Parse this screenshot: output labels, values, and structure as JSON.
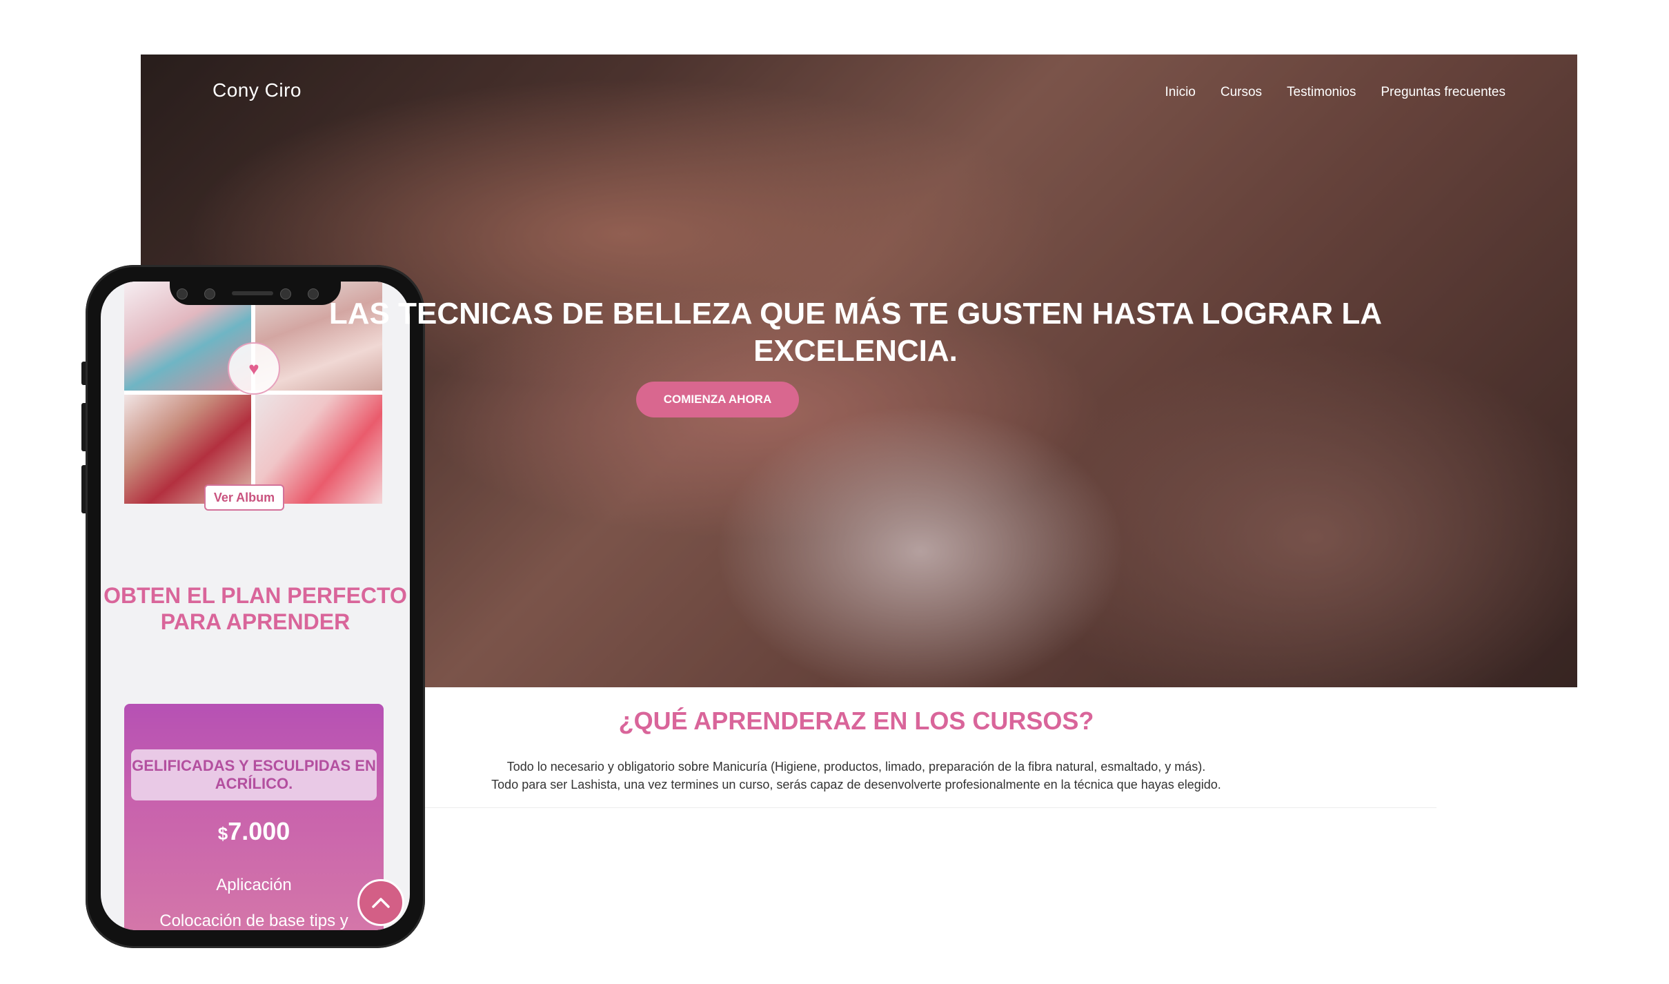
{
  "site": {
    "brand": "Cony Ciro",
    "nav": [
      "Inicio",
      "Cursos",
      "Testimonios",
      "Preguntas frecuentes"
    ]
  },
  "hero": {
    "title": "LAS TECNICAS DE BELLEZA QUE MÁS TE GUSTEN HASTA LOGRAR LA EXCELENCIA.",
    "cta": "COMIENZA AHORA"
  },
  "learn": {
    "title": "¿QUÉ APRENDERAZ EN LOS CURSOS?",
    "line1": "Todo lo necesario y obligatorio sobre Manicuría (Higiene, productos, limado, preparación de la fibra natural, esmaltado, y más).",
    "line2": "Todo para ser Lashista, una vez termines un curso, serás capaz de desenvolverte profesionalmente en la técnica que hayas elegido."
  },
  "mobile": {
    "album_button": "Ver Album",
    "plan_title": "OBTEN EL PLAN PERFECTO PARA APRENDER",
    "card": {
      "name": "GELIFICADAS Y ESCULPIDAS EN ACRÍLICO.",
      "currency": "$",
      "price": "7.000",
      "features": [
        "Aplicación",
        "Colocación de base tips y moldes"
      ]
    }
  },
  "colors": {
    "accent": "#d9659a",
    "cta": "#d9678f",
    "card_gradient_top": "#b651b4",
    "card_gradient_bottom": "#d67aa8"
  },
  "icons": {
    "scroll_top": "chevron-up-icon",
    "logo": "heart-wings-logo"
  }
}
